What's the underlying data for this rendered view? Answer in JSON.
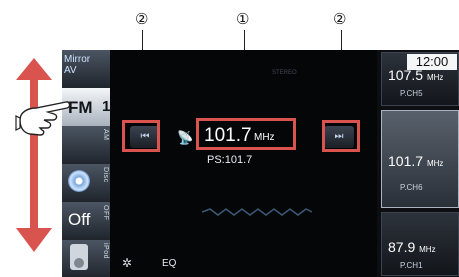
{
  "callouts": {
    "left": "②",
    "center": "①",
    "right": "②"
  },
  "source_bar": {
    "mirror_label": "Mirror\nAV",
    "fm_label": "FM",
    "fm_band": "1",
    "am_vertical": "AM",
    "disc_vertical": "Disc",
    "off_label": "Off",
    "off_vertical": "OFF",
    "ipod_vertical": "iPod"
  },
  "main": {
    "band_indicator": "STEREO",
    "prev_icon": "⏮",
    "next_icon": "⏭",
    "antenna_icon": "📡",
    "frequency": "101.7",
    "frequency_unit": "MHz",
    "ps_text": "PS:101.7",
    "eq_label": "EQ"
  },
  "clock": "12:00",
  "presets": [
    {
      "freq": "107.5",
      "unit": "MHz",
      "channel": "P.CH5"
    },
    {
      "freq": "101.7",
      "unit": "MHz",
      "channel": "P.CH6"
    },
    {
      "freq": "87.9",
      "unit": "MHz",
      "channel": "P.CH1"
    }
  ],
  "colors": {
    "highlight": "#d9534f",
    "screen_bg": "#050608"
  }
}
